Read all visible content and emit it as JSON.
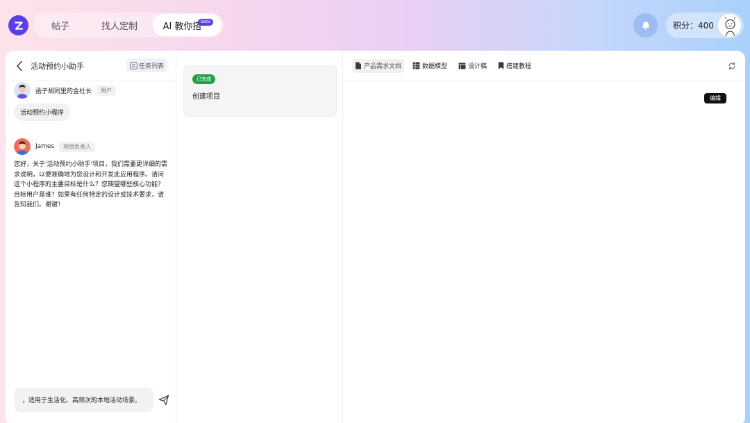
{
  "nav": {
    "tabs": [
      {
        "label": "帖子"
      },
      {
        "label": "找人定制"
      },
      {
        "label": "AI 教你搭",
        "badge": "Beta",
        "active": true
      }
    ]
  },
  "header": {
    "points_label": "积分：400"
  },
  "chat": {
    "title": "活动预约小助手",
    "task_list_label": "任务列表",
    "messages": [
      {
        "name": "函子胡同里的金社长",
        "role": "用户",
        "text": "活动预约小程序"
      },
      {
        "name": "James",
        "role": "项目负责人",
        "text": "您好，关于'活动预约小助手'项目，我们需要更详细的需求说明，以便准确地为您设计和开发此应用程序。请问这个小程序的主要目标是什么？您期望哪些核心功能？目标用户是谁？如果有任何特定的设计或技术要求，请告知我们。谢谢！"
      }
    ],
    "input_value": "，适用于生活化、高频次的本地活动场景。"
  },
  "tasks": {
    "card": {
      "status": "已完成",
      "title": "创建项目"
    }
  },
  "doc": {
    "tabs": [
      {
        "label": "产品需求文档",
        "icon": "file-icon",
        "active": true
      },
      {
        "label": "数据模型",
        "icon": "table-icon"
      },
      {
        "label": "设计稿",
        "icon": "layout-icon"
      },
      {
        "label": "搭建教程",
        "icon": "bookmark-icon"
      }
    ],
    "edit_label": "编辑"
  },
  "colors": {
    "brand": "#5b3ee6",
    "done_green": "#24a148"
  }
}
